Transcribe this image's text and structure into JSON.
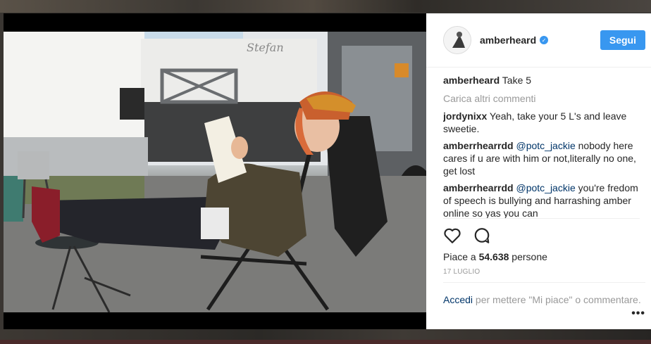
{
  "post": {
    "username": "amberheard",
    "verified_icon": "verified-check-icon",
    "follow_label": "Segui",
    "caption_author": "amberheard",
    "caption_text": "Take 5",
    "load_more_label": "Carica altri commenti",
    "comments": [
      {
        "author": "jordynixx",
        "mention": "",
        "text": "Yeah, take your 5 L's and leave sweetie."
      },
      {
        "author": "amberrhearrdd",
        "mention": "@potc_jackie",
        "text": " nobody here cares if u are with him or not,literally no one, get lost"
      },
      {
        "author": "amberrhearrdd",
        "mention": "@potc_jackie",
        "text": " you're fredom of speech is bullying and harrashing amber online so yas you can"
      }
    ],
    "likes_prefix": "Piace a ",
    "likes_count": "54.638",
    "likes_suffix": " persone",
    "date": "17 LUGLIO",
    "login_link": "Accedi",
    "login_text": " per mettere \"Mi piace\" o commentare.",
    "more_label": "•••"
  },
  "icons": {
    "like": "heart-outline-icon",
    "comment": "speech-bubble-icon",
    "more": "more-options-icon"
  },
  "colors": {
    "accent": "#3897f0",
    "link": "#003569",
    "muted": "#999999",
    "text": "#262626"
  }
}
